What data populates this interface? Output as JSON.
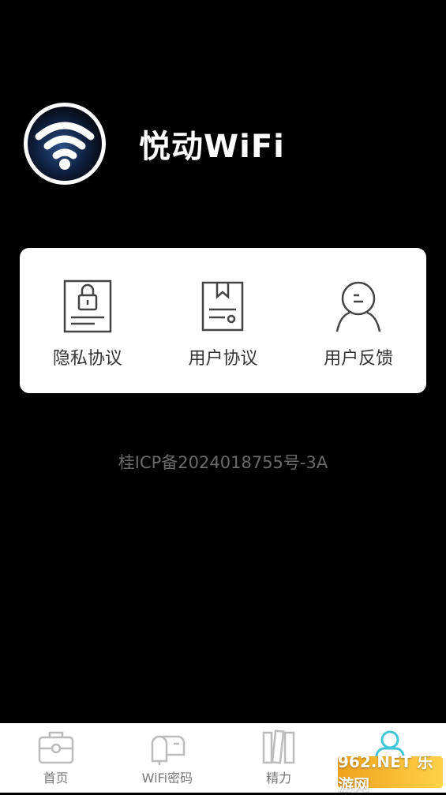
{
  "app": {
    "name": "悦动WiFi"
  },
  "menu": {
    "items": [
      {
        "label": "隐私协议"
      },
      {
        "label": "用户协议"
      },
      {
        "label": "用户反馈"
      }
    ]
  },
  "footer": {
    "icp": "桂ICP备2024018755号-3A"
  },
  "tabbar": {
    "tabs": [
      {
        "label": "首页"
      },
      {
        "label": "WiFi密码"
      },
      {
        "label": "精力"
      },
      {
        "label": "我的"
      }
    ],
    "active_index": 3
  },
  "watermark": {
    "text": "962.NET 乐游网"
  },
  "colors": {
    "accent": "#3ec6d6",
    "background": "#000000",
    "card": "#ffffff"
  }
}
